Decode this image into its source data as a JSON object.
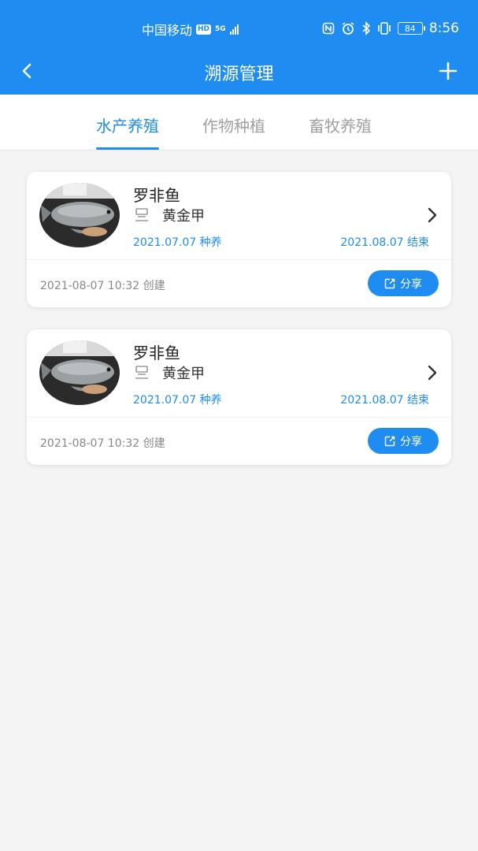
{
  "status_bar": {
    "carrier": "中国移动",
    "hd": "HD",
    "network": "5G",
    "battery": "84",
    "time": "8:56"
  },
  "nav": {
    "title": "溯源管理",
    "back_icon": "chevron-left-icon",
    "add_icon": "plus-icon"
  },
  "tabs": [
    {
      "label": "水产养殖",
      "active": true
    },
    {
      "label": "作物种植",
      "active": false
    },
    {
      "label": "畜牧养殖",
      "active": false
    }
  ],
  "cards": [
    {
      "name": "罗非鱼",
      "person": "黄金甲",
      "start": "2021.07.07 种养",
      "end": "2021.08.07 结束",
      "created": "2021-08-07 10:32 创建",
      "share": "分享"
    },
    {
      "name": "罗非鱼",
      "person": "黄金甲",
      "start": "2021.07.07 种养",
      "end": "2021.08.07 结束",
      "created": "2021-08-07 10:32 创建",
      "share": "分享"
    }
  ],
  "colors": {
    "primary": "#1e8cf0",
    "background": "#f4f4f4",
    "inactive_tab": "#a0a0a0"
  }
}
